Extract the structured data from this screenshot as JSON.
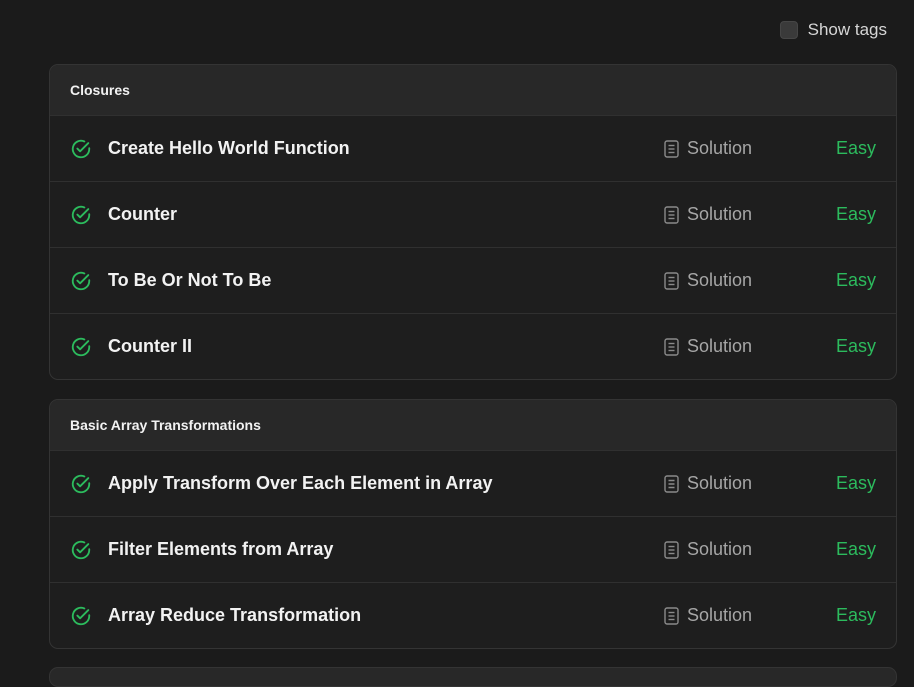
{
  "header": {
    "show_tags_label": "Show tags"
  },
  "sections": [
    {
      "title": "Closures",
      "items": [
        {
          "title": "Create Hello World Function",
          "solution_label": "Solution",
          "difficulty": "Easy"
        },
        {
          "title": "Counter",
          "solution_label": "Solution",
          "difficulty": "Easy"
        },
        {
          "title": "To Be Or Not To Be",
          "solution_label": "Solution",
          "difficulty": "Easy"
        },
        {
          "title": "Counter II",
          "solution_label": "Solution",
          "difficulty": "Easy"
        }
      ]
    },
    {
      "title": "Basic Array Transformations",
      "items": [
        {
          "title": "Apply Transform Over Each Element in Array",
          "solution_label": "Solution",
          "difficulty": "Easy"
        },
        {
          "title": "Filter Elements from Array",
          "solution_label": "Solution",
          "difficulty": "Easy"
        },
        {
          "title": "Array Reduce Transformation",
          "solution_label": "Solution",
          "difficulty": "Easy"
        }
      ]
    }
  ],
  "icons": {
    "solved": "check-circle-icon",
    "solution": "document-icon"
  },
  "colors": {
    "easy": "#2cbb5d",
    "solved_check": "#2cbb5d",
    "background": "#1b1b1b"
  }
}
